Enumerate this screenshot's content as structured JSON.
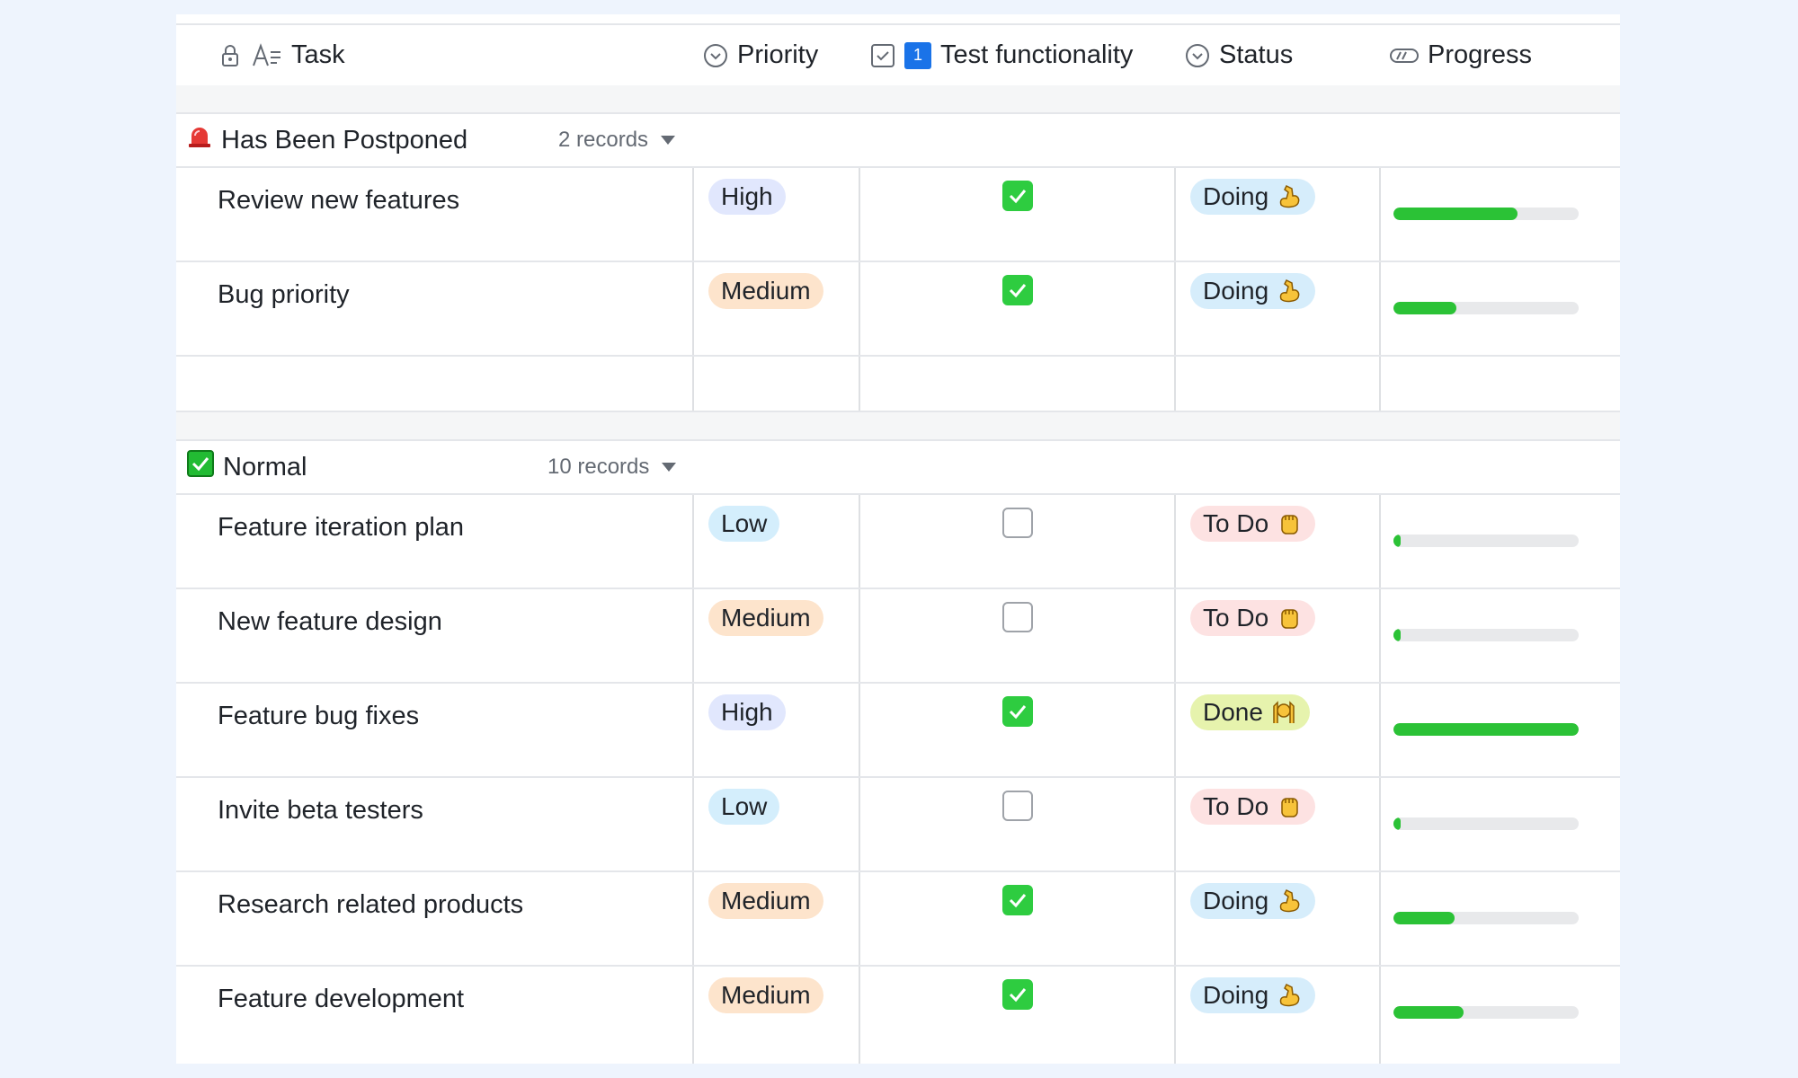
{
  "header": {
    "task": "Task",
    "priority": "Priority",
    "test": "Test functionality",
    "test_badge": "1",
    "status": "Status",
    "progress": "Progress"
  },
  "groups": [
    {
      "title": "Has Been Postponed",
      "count": "2 records",
      "icon": "siren-icon",
      "rows": [
        {
          "task": "Review new features",
          "priority": "High",
          "tested": true,
          "status": "Doing",
          "progress": 0.67
        },
        {
          "task": "Bug priority",
          "priority": "Medium",
          "tested": true,
          "status": "Doing",
          "progress": 0.34
        }
      ]
    },
    {
      "title": "Normal",
      "count": "10 records",
      "icon": "green-check-icon",
      "rows": [
        {
          "task": "Feature iteration plan",
          "priority": "Low",
          "tested": false,
          "status": "To Do",
          "progress": 0.04
        },
        {
          "task": "New feature design",
          "priority": "Medium",
          "tested": false,
          "status": "To Do",
          "progress": 0.04
        },
        {
          "task": "Feature bug fixes",
          "priority": "High",
          "tested": true,
          "status": "Done",
          "progress": 1.0
        },
        {
          "task": "Invite beta testers",
          "priority": "Low",
          "tested": false,
          "status": "To Do",
          "progress": 0.04
        },
        {
          "task": "Research related products",
          "priority": "Medium",
          "tested": true,
          "status": "Doing",
          "progress": 0.33
        },
        {
          "task": "Feature development",
          "priority": "Medium",
          "tested": true,
          "status": "Doing",
          "progress": 0.38
        }
      ]
    }
  ],
  "colors": {
    "accent_green": "#2bc236",
    "high": "#e1e7fd",
    "medium": "#fde4cc",
    "low": "#d4eefc"
  }
}
